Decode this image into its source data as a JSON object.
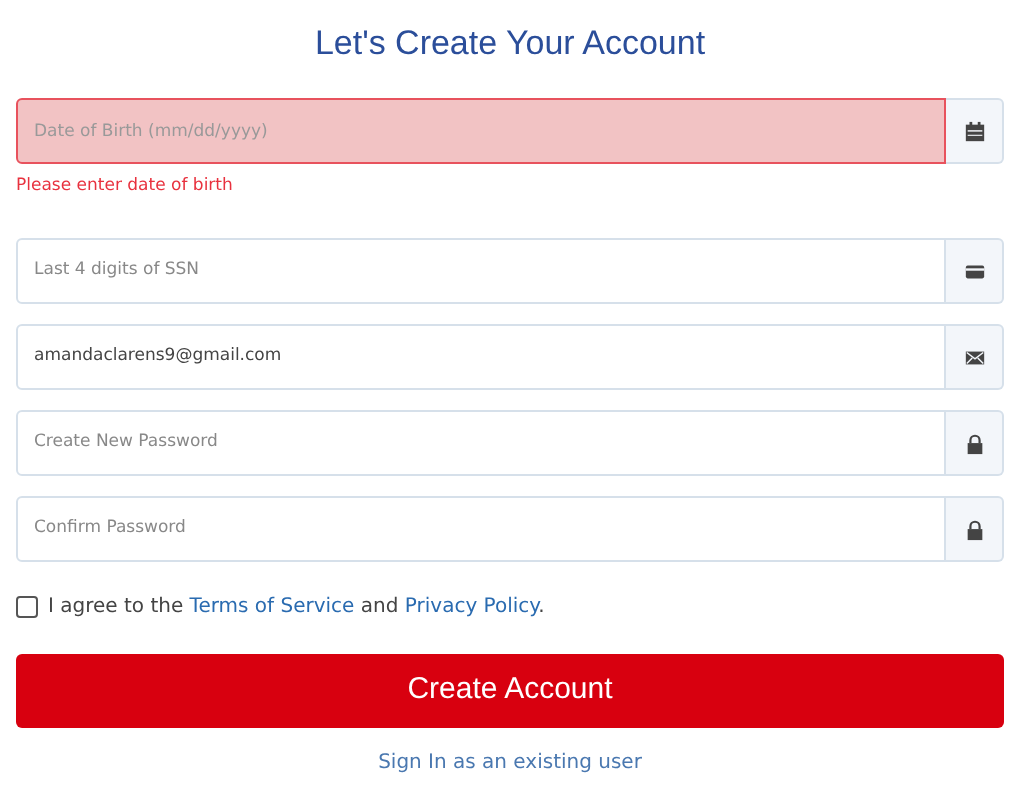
{
  "title": "Let's Create Your Account",
  "fields": [
    {
      "kind": "calendar",
      "placeholder": "Date of Birth (mm/dd/yyyy)",
      "invalid": true,
      "error": "Please enter date of birth"
    },
    {
      "kind": "card",
      "placeholder": "Last 4 digits of SSN",
      "invalid": false
    },
    {
      "kind": "envelope",
      "value": "amandaclarens9@gmail.com",
      "invalid": false
    },
    {
      "kind": "lock",
      "placeholder": "Create New Password",
      "invalid": false
    },
    {
      "kind": "lock",
      "placeholder": "Confirm Password",
      "invalid": false
    }
  ],
  "agreement": {
    "checked": false,
    "parts": [
      {
        "kind": "text",
        "text": "I agree to the"
      },
      {
        "kind": "link",
        "text": "Terms of Service"
      },
      {
        "kind": "text",
        "text": "and"
      },
      {
        "kind": "link",
        "text": "Privacy Policy"
      },
      {
        "kind": "text",
        "text": "."
      }
    ]
  },
  "submit": "Create Account",
  "signin_link": "Sign In as an existing user"
}
